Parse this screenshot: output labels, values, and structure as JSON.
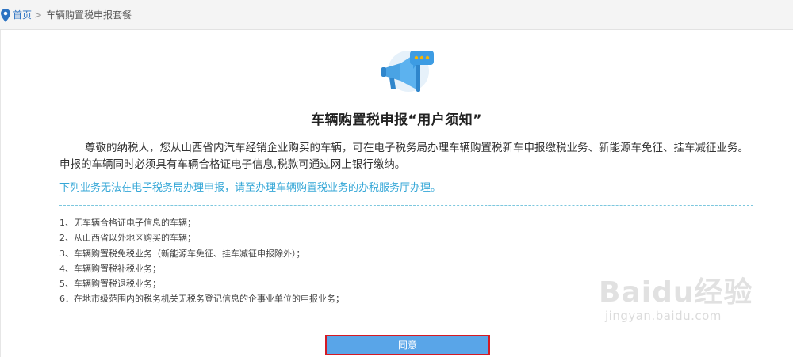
{
  "breadcrumb": {
    "home": "首页",
    "separator": ">",
    "current": "车辆购置税申报套餐"
  },
  "notice_panel": {
    "title": "车辆购置税申报“用户须知”",
    "intro": "尊敬的纳税人，您从山西省内汽车经销企业购买的车辆，可在电子税务局办理车辆购置税新车申报缴税业务、新能源车免征、挂车减征业务。申报的车辆同时必须具有车辆合格证电子信息,税款可通过网上银行缴纳。",
    "notice": "下列业务无法在电子税务局办理申报，请至办理车辆购置税业务的办税服务厅办理。",
    "items": [
      "1、无车辆合格证电子信息的车辆；",
      "2、从山西省以外地区购买的车辆；",
      "3、车辆购置税免税业务（新能源车免征、挂车减征申报除外）；",
      "4、车辆购置税补税业务；",
      "5、车辆购置税退税业务；",
      "6．在地市级范围内的税务机关无税务登记信息的企事业单位的申报业务；"
    ],
    "agree_label": "同意"
  },
  "watermark": {
    "brand": "Baidu经验",
    "url": "jingyan.baidu.com"
  },
  "colors": {
    "link": "#2d73c2",
    "notice": "#35a7d7",
    "button": "#59a5e8",
    "button_highlight": "#d51a24"
  },
  "icons": {
    "breadcrumb": "location-pin-icon",
    "header": "megaphone-icon"
  }
}
